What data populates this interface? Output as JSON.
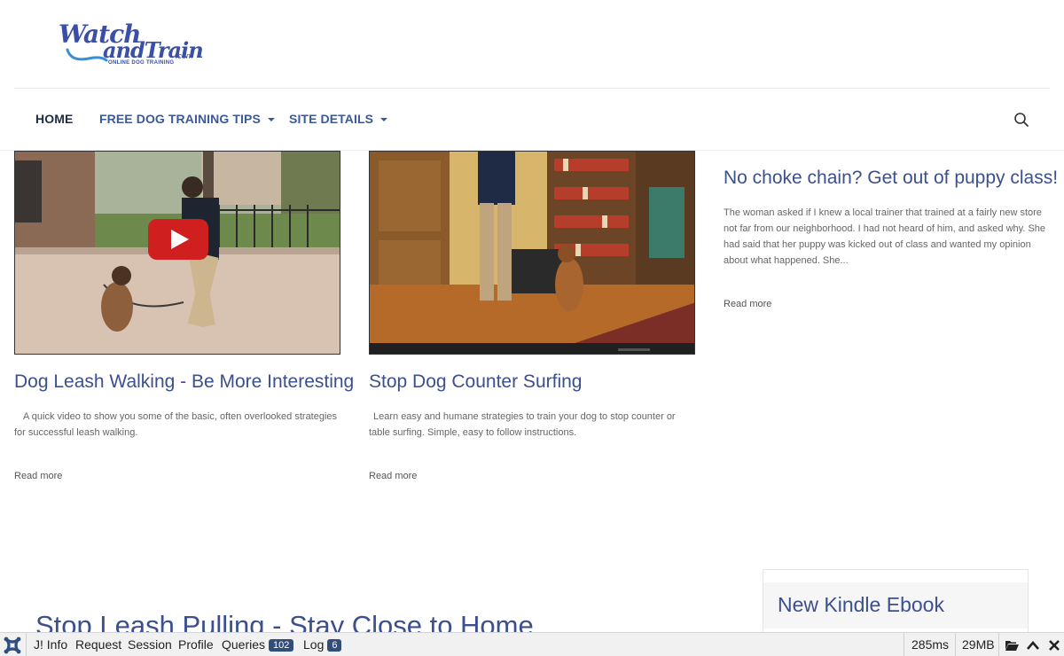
{
  "brand": {
    "logo_line1": "Watch",
    "logo_line2": "andTrain",
    "logo_tld": ".com",
    "logo_tagline": "ONLINE DOG TRAINING"
  },
  "nav": {
    "items": [
      {
        "label": "HOME",
        "active": true,
        "dropdown": false
      },
      {
        "label": "FREE DOG TRAINING TIPS",
        "active": false,
        "dropdown": true
      },
      {
        "label": "SITE DETAILS",
        "active": false,
        "dropdown": true
      }
    ],
    "search_icon": "search-icon"
  },
  "articles": [
    {
      "title": "Dog Leash Walking - Be More Interesting",
      "excerpt": "A quick video to show you some of the basic, often overlooked strategies for successful leash walking.",
      "read_more": "Read more",
      "has_video_play": true
    },
    {
      "title": "Stop Dog Counter Surfing",
      "excerpt": "Learn easy and humane strategies to train your dog to stop counter or table surfing. Simple, easy to follow instructions.",
      "read_more": "Read more",
      "has_video_play": false
    },
    {
      "title": "No choke chain? Get out of puppy class!",
      "excerpt": "The woman asked if I knew a local trainer that trained at a fairly new store not far from our neighborhood. I had not heard of him, and asked why. She had said that her puppy was kicked out of class and wanted my opinion about what happened. She...",
      "read_more": "Read more",
      "has_video_play": false
    }
  ],
  "next_article_title": "Stop Leash Pulling - Stay Close to Home",
  "sidebar": {
    "box_title": "New Kindle Ebook"
  },
  "debug_bar": {
    "items": [
      {
        "label": "J! Info"
      },
      {
        "label": "Request"
      },
      {
        "label": "Session"
      },
      {
        "label": "Profile"
      },
      {
        "label": "Queries",
        "badge": "102"
      },
      {
        "label": "Log",
        "badge": "6"
      }
    ],
    "time": "285ms",
    "memory": "29MB"
  },
  "colors": {
    "link_blue": "#3c4f8e",
    "nav_blue": "#3b5998",
    "badge_bg": "#314e79"
  }
}
